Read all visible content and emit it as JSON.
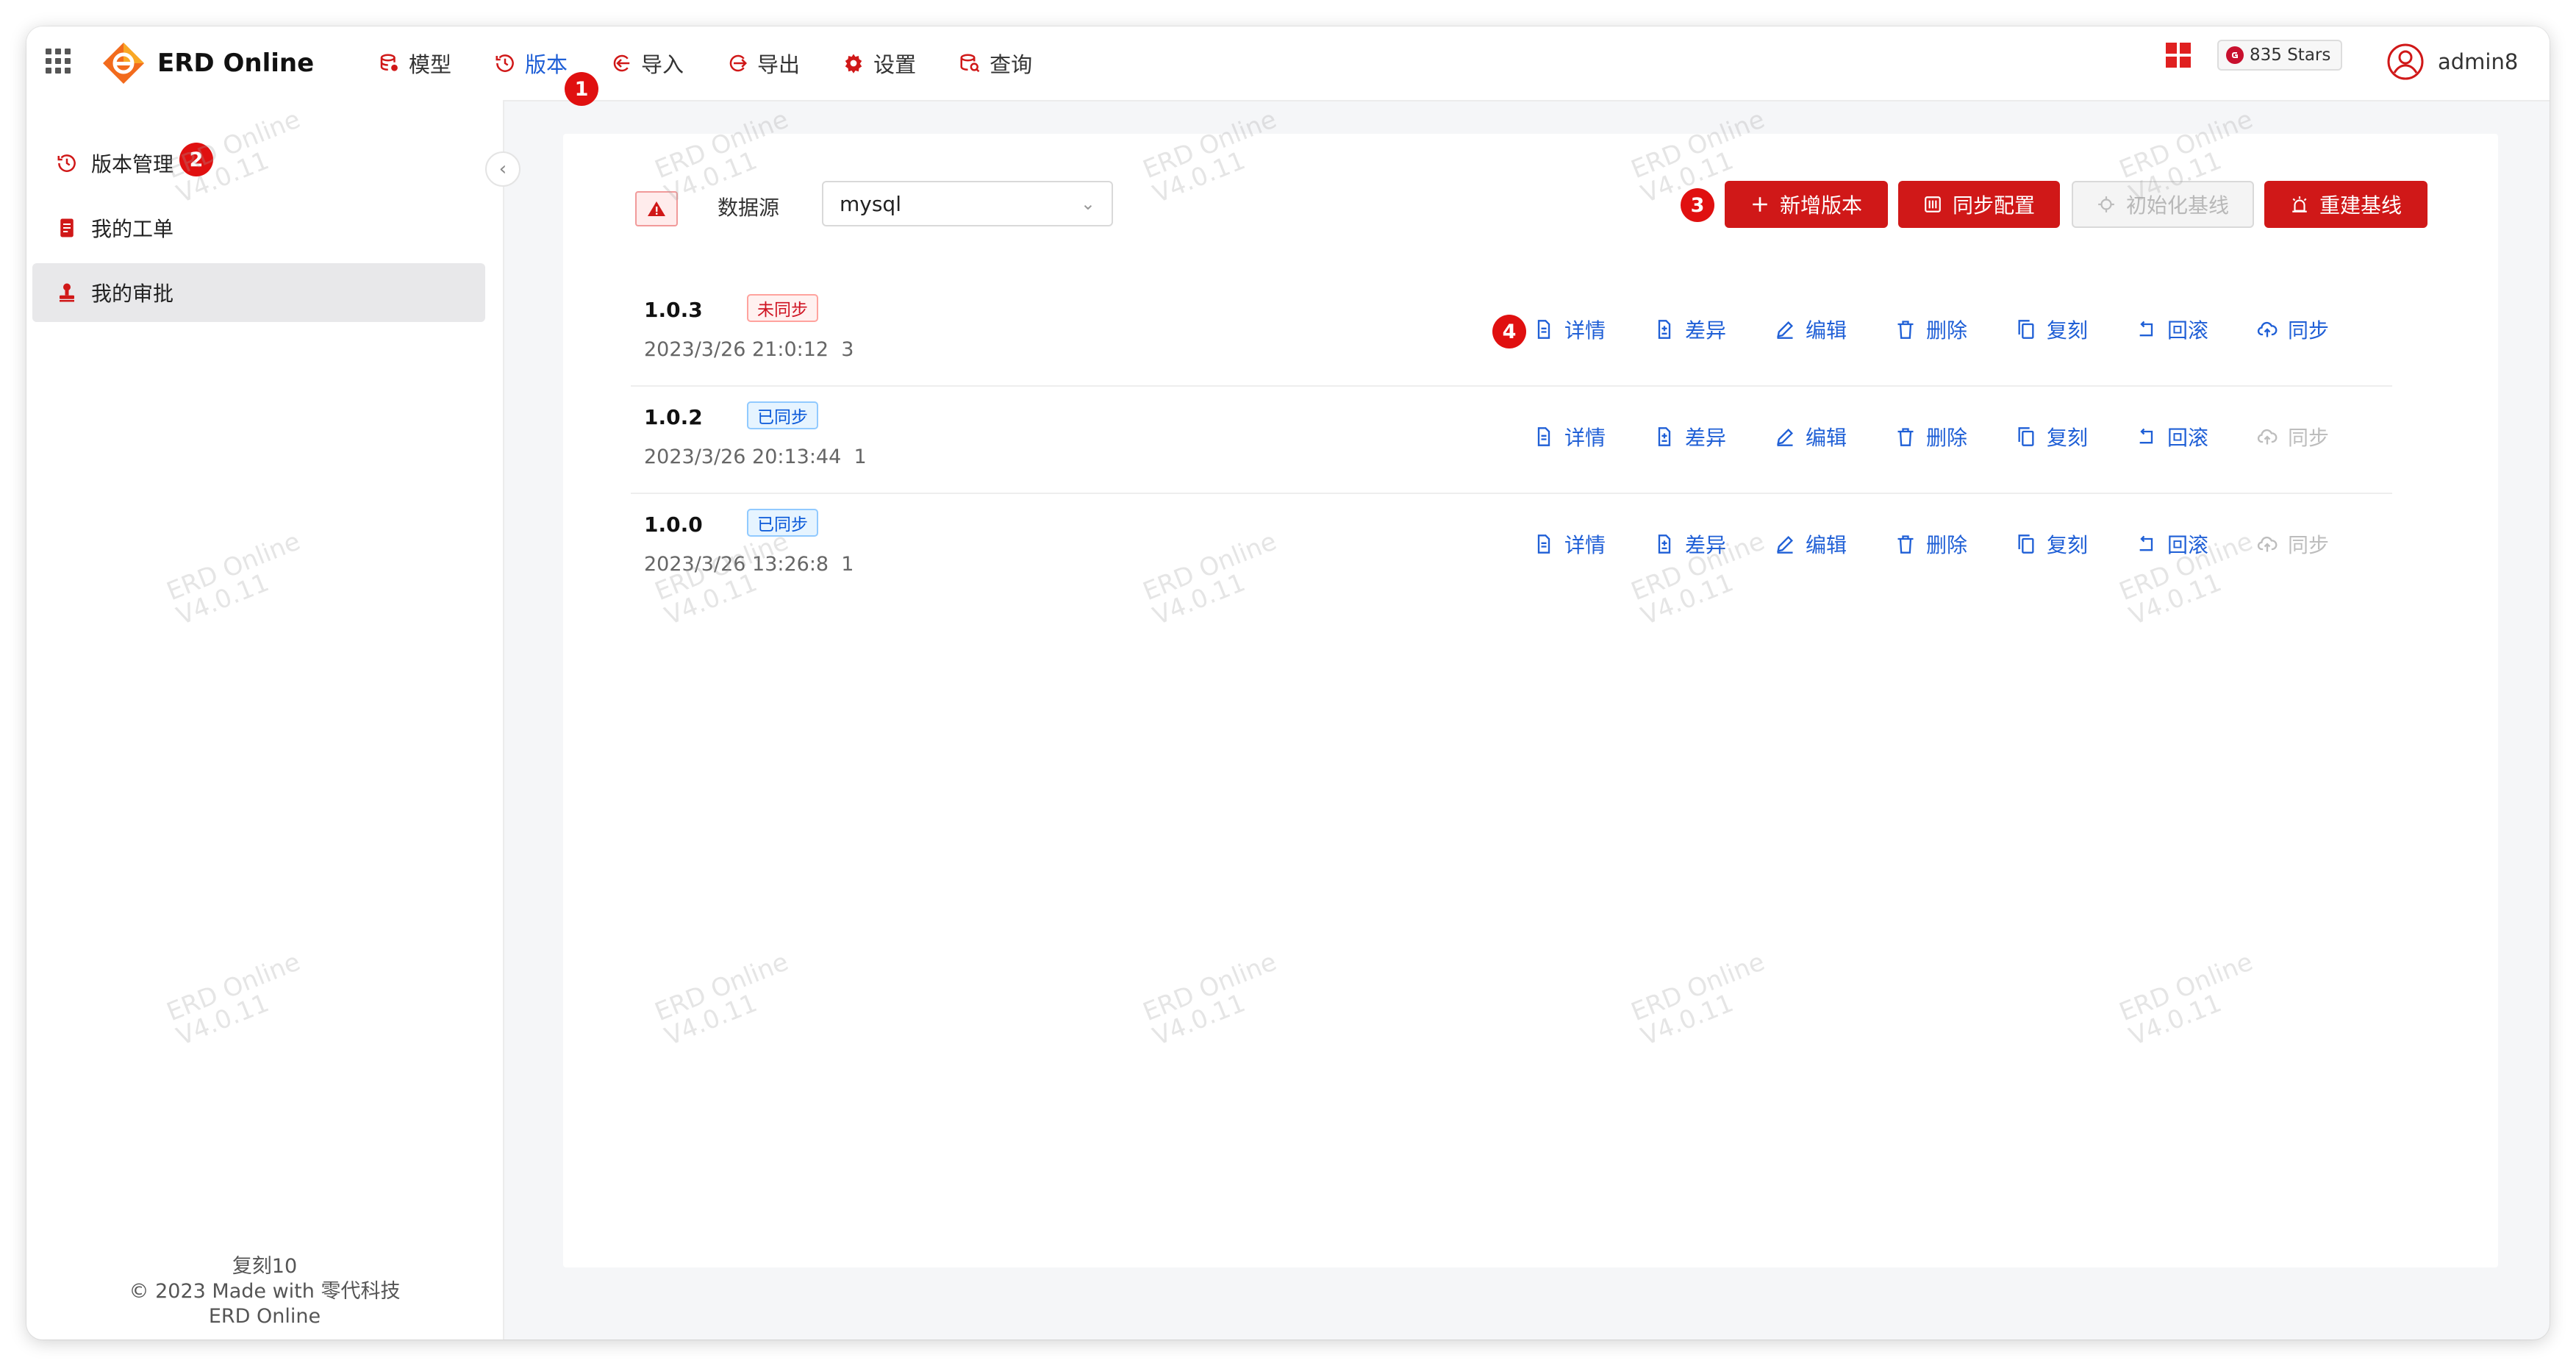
{
  "app": {
    "title": "ERD Online"
  },
  "nav": [
    {
      "label": "模型",
      "icon": "database-icon",
      "active": false
    },
    {
      "label": "版本",
      "icon": "history-icon",
      "active": true
    },
    {
      "label": "导入",
      "icon": "import-icon",
      "active": false
    },
    {
      "label": "导出",
      "icon": "export-icon",
      "active": false
    },
    {
      "label": "设置",
      "icon": "gear-icon",
      "active": false
    },
    {
      "label": "查询",
      "icon": "query-icon",
      "active": false
    }
  ],
  "badges": {
    "b1": "1",
    "b2": "2",
    "b3": "3",
    "b4": "4"
  },
  "header": {
    "stars": "835 Stars",
    "user": "admin8"
  },
  "sidebar": {
    "items": [
      {
        "label": "版本管理",
        "icon": "history-icon"
      },
      {
        "label": "我的工单",
        "icon": "document-icon"
      },
      {
        "label": "我的审批",
        "icon": "stamp-icon"
      }
    ],
    "footer": {
      "line1": "复刻10",
      "line2": "© 2023 Made with 零代科技",
      "line3": "ERD Online"
    }
  },
  "toolbar": {
    "datasource_label": "数据源",
    "datasource_value": "mysql",
    "buttons": {
      "add": "新增版本",
      "sync_config": "同步配置",
      "init_baseline": "初始化基线",
      "rebuild_baseline": "重建基线"
    }
  },
  "actions": {
    "detail": "详情",
    "diff": "差异",
    "edit": "编辑",
    "delete": "删除",
    "copy": "复刻",
    "rollback": "回滚",
    "sync": "同步"
  },
  "versions": [
    {
      "version": "1.0.3",
      "status": "未同步",
      "status_color": "red",
      "time": "2023/3/26 21:0:12",
      "count": "3",
      "sync_enabled": true
    },
    {
      "version": "1.0.2",
      "status": "已同步",
      "status_color": "blue",
      "time": "2023/3/26 20:13:44",
      "count": "1",
      "sync_enabled": false
    },
    {
      "version": "1.0.0",
      "status": "已同步",
      "status_color": "blue",
      "time": "2023/3/26 13:26:8",
      "count": "1",
      "sync_enabled": false
    }
  ],
  "watermark": {
    "line1": "ERD Online",
    "line2": "V4.0.11"
  },
  "colors": {
    "accent": "#1f5fd6",
    "primary_red": "#d01818",
    "badge_red": "#e01010"
  }
}
